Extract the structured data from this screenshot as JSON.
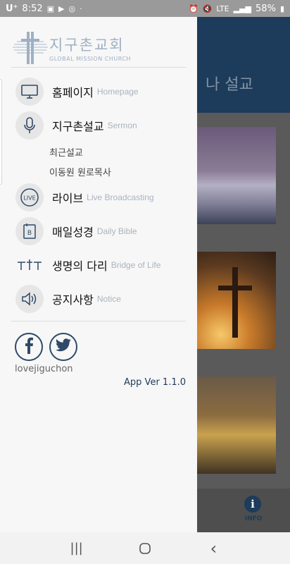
{
  "status_bar": {
    "carrier": "U⁺",
    "time": "8:52",
    "network": "LTE",
    "battery": "58%"
  },
  "background_app": {
    "header_title": "나 설교",
    "tab_info_label": "INFO"
  },
  "drawer": {
    "logo_title": "지구촌교회",
    "logo_subtitle": "GLOBAL MISSION CHURCH",
    "menu": [
      {
        "label": "홈페이지",
        "sub": "Homepage",
        "icon": "monitor-icon"
      },
      {
        "label": "지구촌설교",
        "sub": "Sermon",
        "icon": "microphone-icon"
      },
      {
        "label": "라이브",
        "sub": "Live Broadcasting",
        "icon": "live-icon"
      },
      {
        "label": "매일성경",
        "sub": "Daily Bible",
        "icon": "bible-icon"
      },
      {
        "label": "생명의 다리",
        "sub": "Bridge of Life",
        "icon": "bridge-icon"
      },
      {
        "label": "공지사항",
        "sub": "Notice",
        "icon": "speaker-icon"
      }
    ],
    "sermon_subitems": [
      "최근설교",
      "이동원 원로목사"
    ],
    "social": {
      "facebook_icon": "facebook-icon",
      "twitter_icon": "twitter-icon",
      "handle": "lovejiguchon"
    },
    "app_version": "App Ver 1.1.0"
  },
  "navbar": {
    "recent": "|||",
    "home": "○",
    "back": "‹"
  },
  "colors": {
    "accent": "#1e3a58",
    "logo": "#9fb0c4",
    "drawer_bg": "#f7f7f7"
  }
}
